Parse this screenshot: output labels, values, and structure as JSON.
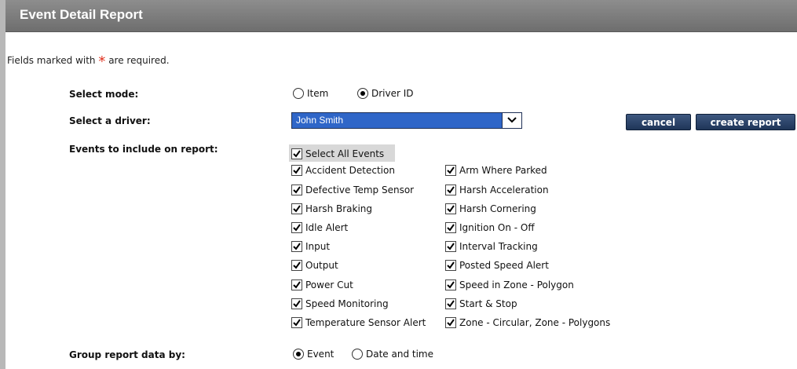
{
  "header": {
    "title": "Event Detail Report"
  },
  "required_note": {
    "text": "Fields marked with",
    "star": "*",
    "suffix": "are required."
  },
  "mode": {
    "label": "Select mode:",
    "options": [
      {
        "label": "Item",
        "selected": false
      },
      {
        "label": "Driver ID",
        "selected": true
      }
    ]
  },
  "driver": {
    "label": "Select a driver:",
    "value": "John Smith"
  },
  "buttons": {
    "cancel": "cancel",
    "create": "create report"
  },
  "events": {
    "label": "Events to include on report:",
    "select_all": "Select All Events",
    "left": [
      "Accident Detection",
      "Defective Temp Sensor",
      "Harsh Braking",
      "Idle Alert",
      "Input",
      "Output",
      "Power Cut",
      "Speed Monitoring",
      "Temperature Sensor Alert"
    ],
    "right": [
      "Arm Where Parked",
      "Harsh Acceleration",
      "Harsh Cornering",
      "Ignition On - Off",
      "Interval Tracking",
      "Posted Speed Alert",
      "Speed in Zone - Polygon",
      "Start & Stop",
      "Zone - Circular, Zone - Polygons"
    ]
  },
  "group": {
    "label": "Group report data by:",
    "options": [
      {
        "label": "Event",
        "selected": true
      },
      {
        "label": "Date and time",
        "selected": false
      }
    ]
  },
  "colors": {
    "header": "#7a7a7a",
    "select_bg": "#2f66c8",
    "button": "#2a4066",
    "required_star": "#e0301e"
  }
}
